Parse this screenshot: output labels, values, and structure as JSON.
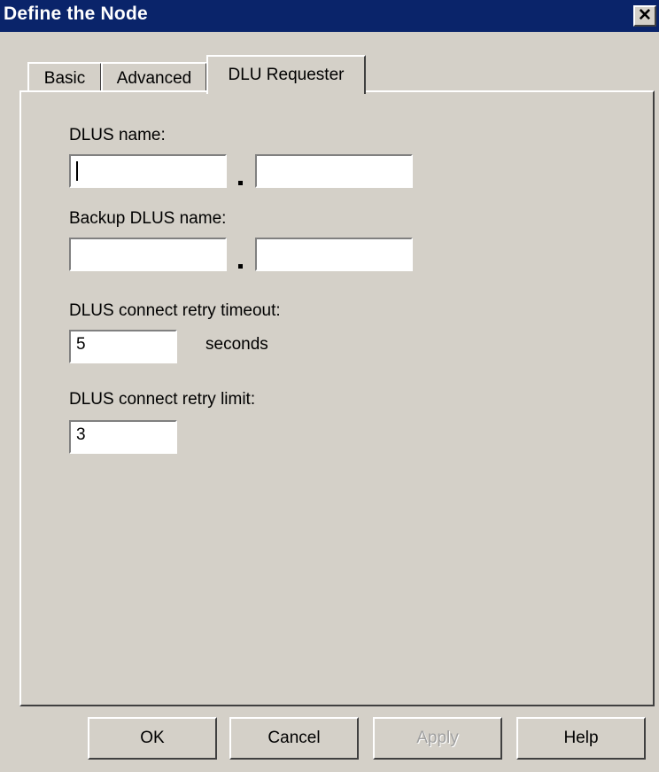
{
  "window": {
    "title": "Define the Node",
    "close_glyph": "✕"
  },
  "tabs": [
    {
      "label": "Basic"
    },
    {
      "label": "Advanced"
    },
    {
      "label": "DLU Requester",
      "active": true
    }
  ],
  "form": {
    "dlus_name_label": "DLUS name:",
    "dlus_name_network": "",
    "dlus_name_cp": "",
    "backup_dlus_name_label": "Backup DLUS name:",
    "backup_dlus_name_network": "",
    "backup_dlus_name_cp": "",
    "separator": ".",
    "retry_timeout_label": "DLUS connect retry timeout:",
    "retry_timeout_value": "5",
    "retry_timeout_unit": "seconds",
    "retry_limit_label": "DLUS connect retry limit:",
    "retry_limit_value": "3"
  },
  "buttons": {
    "ok": "OK",
    "cancel": "Cancel",
    "apply": "Apply",
    "help": "Help"
  },
  "icons": {
    "close": "close-icon"
  }
}
